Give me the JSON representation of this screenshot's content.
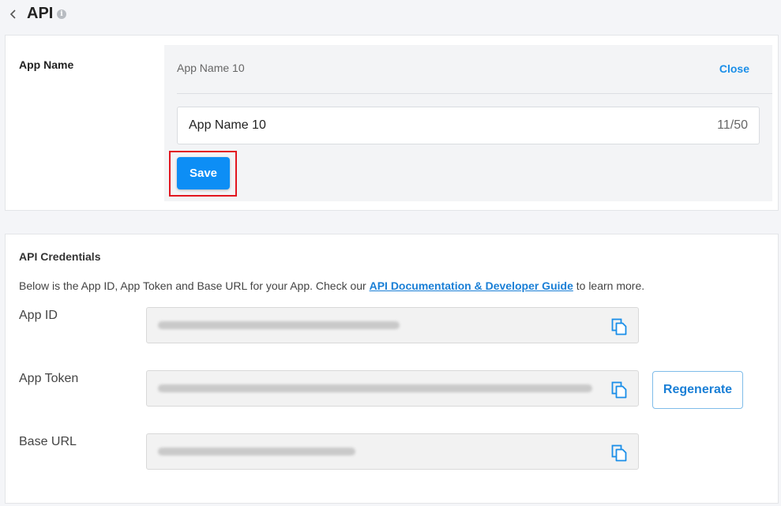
{
  "header": {
    "title": "API",
    "back_icon": "chevron-left-icon",
    "info_icon": "info-icon",
    "info_glyph": "i"
  },
  "app_name_section": {
    "label": "App Name",
    "panel_name": "App Name 10",
    "close_label": "Close",
    "input_value": "App Name 10",
    "char_count": "11/50",
    "save_label": "Save"
  },
  "credentials": {
    "title": "API Credentials",
    "description_before": "Below is the App ID, App Token and Base URL for your App. Check our ",
    "doc_link": "API Documentation & Developer Guide",
    "description_after": " to learn more.",
    "fields": [
      {
        "label": "App ID",
        "value_redacted": true
      },
      {
        "label": "App Token",
        "value_redacted": true
      },
      {
        "label": "Base URL",
        "value_redacted": true
      }
    ],
    "copy_icon": "copy-icon",
    "regenerate_label": "Regenerate"
  },
  "colors": {
    "accent": "#0d8ef5",
    "link": "#1a7fd6",
    "highlight": "#e2161f",
    "background": "#f4f5f8"
  }
}
